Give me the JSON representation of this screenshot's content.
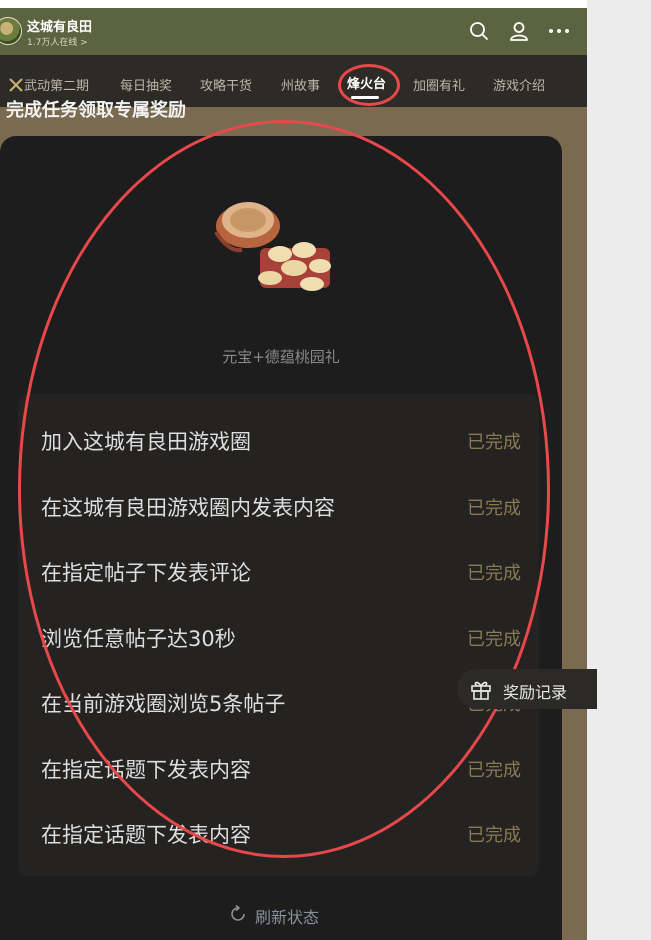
{
  "app": {
    "title": "这城有良田",
    "online": "1.7万人在线 >"
  },
  "header_icons": [
    "search-icon",
    "user-icon",
    "more-icon"
  ],
  "tabs": [
    {
      "label": "武动第二期",
      "icon": "crossed-swords-icon"
    },
    {
      "label": "每日抽奖"
    },
    {
      "label": "攻略干货"
    },
    {
      "label": "州故事"
    },
    {
      "label": "烽火台",
      "active": true
    },
    {
      "label": "加圈有礼"
    },
    {
      "label": "游戏介绍"
    }
  ],
  "section": {
    "heading_partial": "完成任务领取专属奖励"
  },
  "reward": {
    "name": "元宝+德蕴桃园礼"
  },
  "tasks": [
    {
      "name": "加入这城有良田游戏圈",
      "status": "已完成"
    },
    {
      "name": "在这城有良田游戏圈内发表内容",
      "status": "已完成"
    },
    {
      "name": "在指定帖子下发表评论",
      "status": "已完成"
    },
    {
      "name": "浏览任意帖子达30秒",
      "status": "已完成"
    },
    {
      "name": "在当前游戏圈浏览5条帖子",
      "status": "已完成"
    },
    {
      "name": "在指定话题下发表内容",
      "status": "已完成"
    },
    {
      "name": "在指定话题下发表内容",
      "status": "已完成"
    }
  ],
  "refresh": {
    "label": "刷新状态"
  },
  "floating": {
    "label": "奖励记录",
    "icon": "gift-icon"
  },
  "colors": {
    "accent_circle": "#e8484a",
    "status_done": "#8a7a52",
    "panel": "#1d1d1d",
    "header": "#5c6340"
  }
}
